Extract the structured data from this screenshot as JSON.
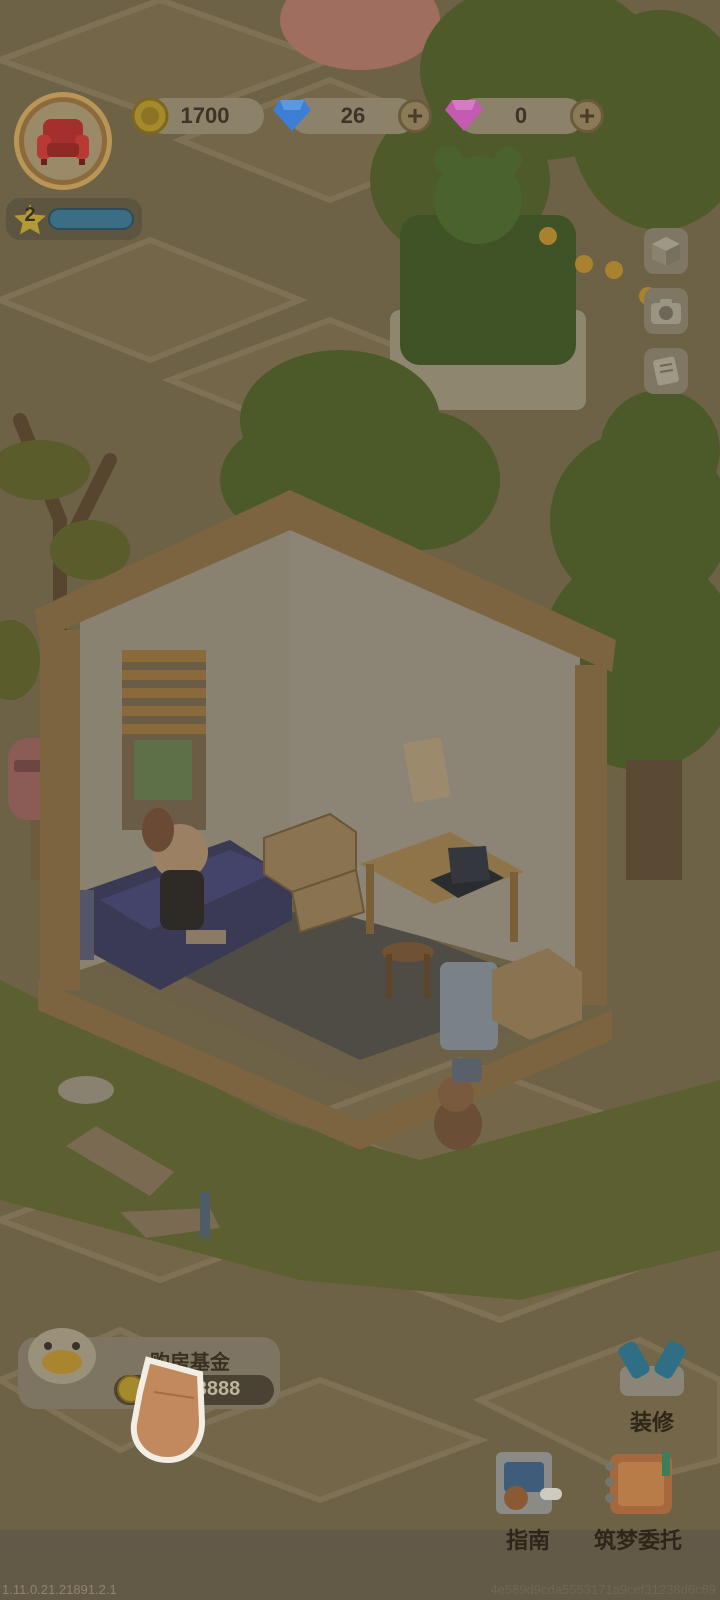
{
  "hud": {
    "coins": "1700",
    "diamonds": "26",
    "gems": "0",
    "level": "2"
  },
  "fund": {
    "title": "购房基金",
    "progress": "00/3888"
  },
  "actions": {
    "renovate_label": "装修",
    "guide_label": "指南",
    "commission_label": "筑梦委托"
  },
  "footer": {
    "version": "1.11.0.21.21891.2.1",
    "build_hash": "4e589d9cda5553171a9cef31238d6c89"
  },
  "icons": {
    "avatar": "armchair-icon",
    "coin": "coin-icon",
    "diamond": "diamond-icon",
    "gem": "pink-gem-icon",
    "level": "star-icon",
    "side_1": "cube-icon",
    "side_2": "camera-icon",
    "side_3": "note-icon"
  },
  "colors": {
    "accent_red": "#c0302c",
    "diamond_blue": "#3d7fd6",
    "gem_pink": "#c45ab2",
    "xp_bar": "#3b6d84"
  }
}
